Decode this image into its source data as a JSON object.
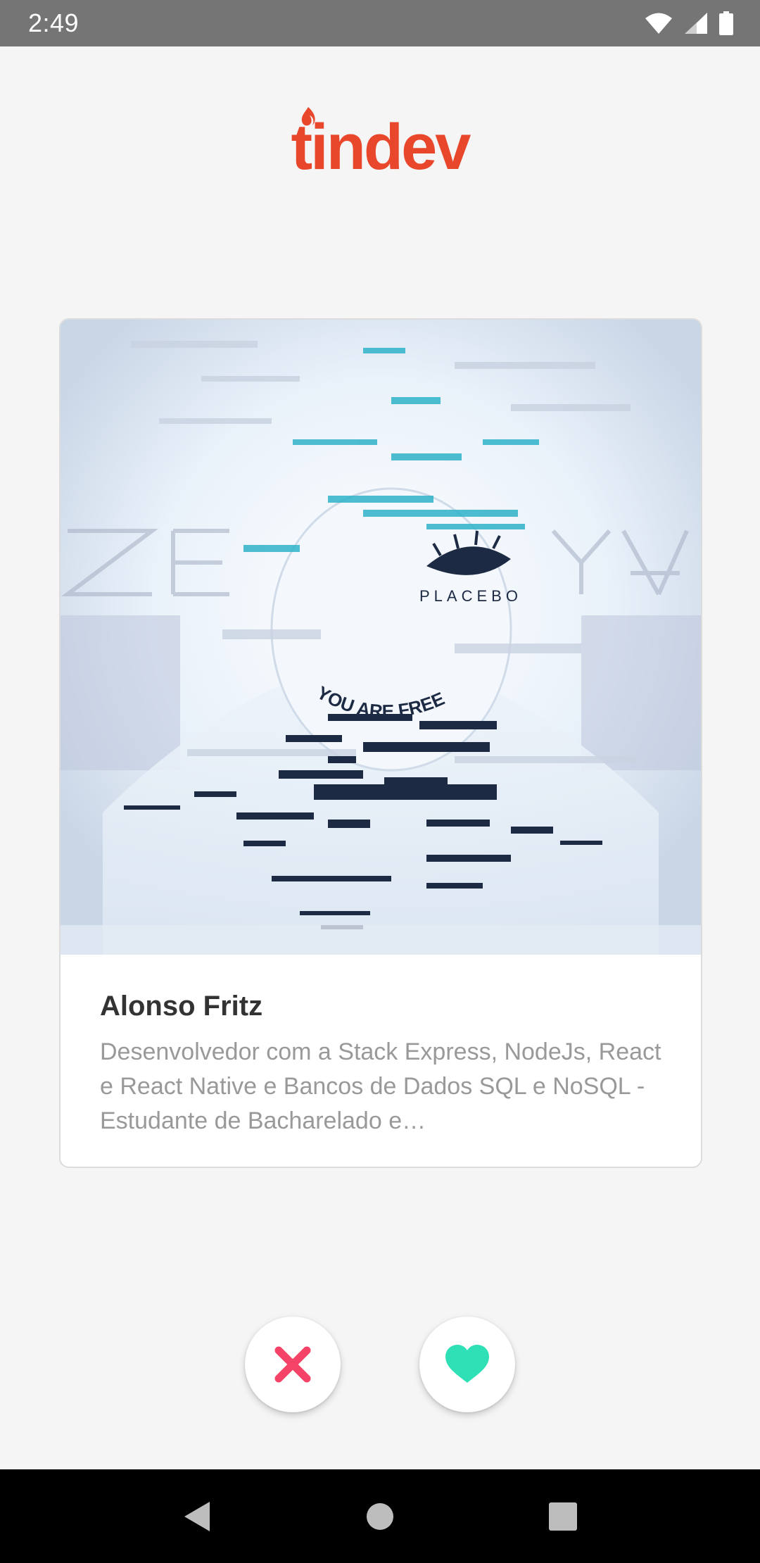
{
  "status_bar": {
    "time": "2:49",
    "icons": [
      "wifi-icon",
      "signal-icon",
      "battery-icon"
    ]
  },
  "app": {
    "logo_text": "tindev",
    "accent_color": "#e8472b"
  },
  "card": {
    "photo_alt": "ZERO DAY PLACEBO YOU ARE FREE",
    "name": "Alonso Fritz",
    "bio": "Desenvolvedor com a Stack Express, NodeJs, React e React Native e Bancos de Dados SQL e NoSQL - Estudante de Bacharelado e…"
  },
  "actions": {
    "dislike_icon": "close-icon",
    "dislike_color": "#f44366",
    "like_icon": "heart-icon",
    "like_color": "#2fe0b7"
  },
  "nav_bar": {
    "buttons": [
      "back-icon",
      "home-icon",
      "recents-icon"
    ]
  }
}
